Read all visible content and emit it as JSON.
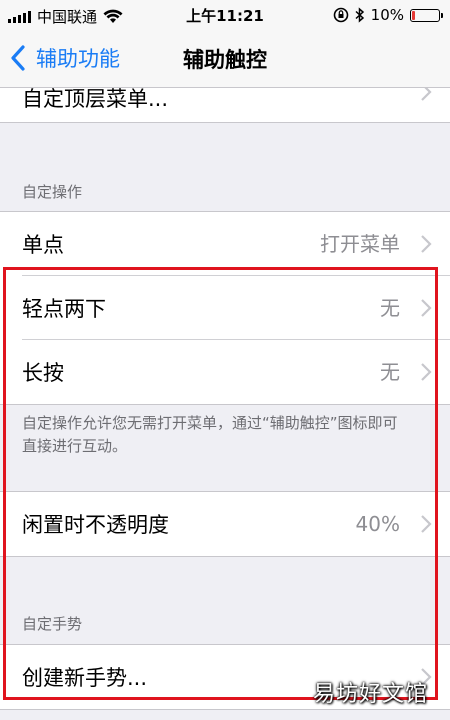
{
  "status_bar": {
    "carrier": "中国联通",
    "time": "上午11:21",
    "battery_percent": "10%",
    "battery_level": 0.1
  },
  "nav": {
    "back_label": "辅助功能",
    "title": "辅助触控"
  },
  "top_partial_item": {
    "label": "自定顶层菜单..."
  },
  "custom_actions": {
    "header": "自定操作",
    "items": [
      {
        "label": "单点",
        "value": "打开菜单"
      },
      {
        "label": "轻点两下",
        "value": "无"
      },
      {
        "label": "长按",
        "value": "无"
      }
    ],
    "footer": "自定操作允许您无需打开菜单，通过“辅助触控”图标即可直接进行互动。"
  },
  "idle_opacity": {
    "label": "闲置时不透明度",
    "value": "40%"
  },
  "custom_gestures": {
    "header": "自定手势",
    "items": [
      {
        "label": "创建新手势..."
      }
    ]
  },
  "watermark": "易坊好文馆",
  "colors": {
    "accent": "#1a7cf5",
    "highlight": "#e0141e",
    "battery": "#e53935",
    "background": "#efeff4"
  }
}
